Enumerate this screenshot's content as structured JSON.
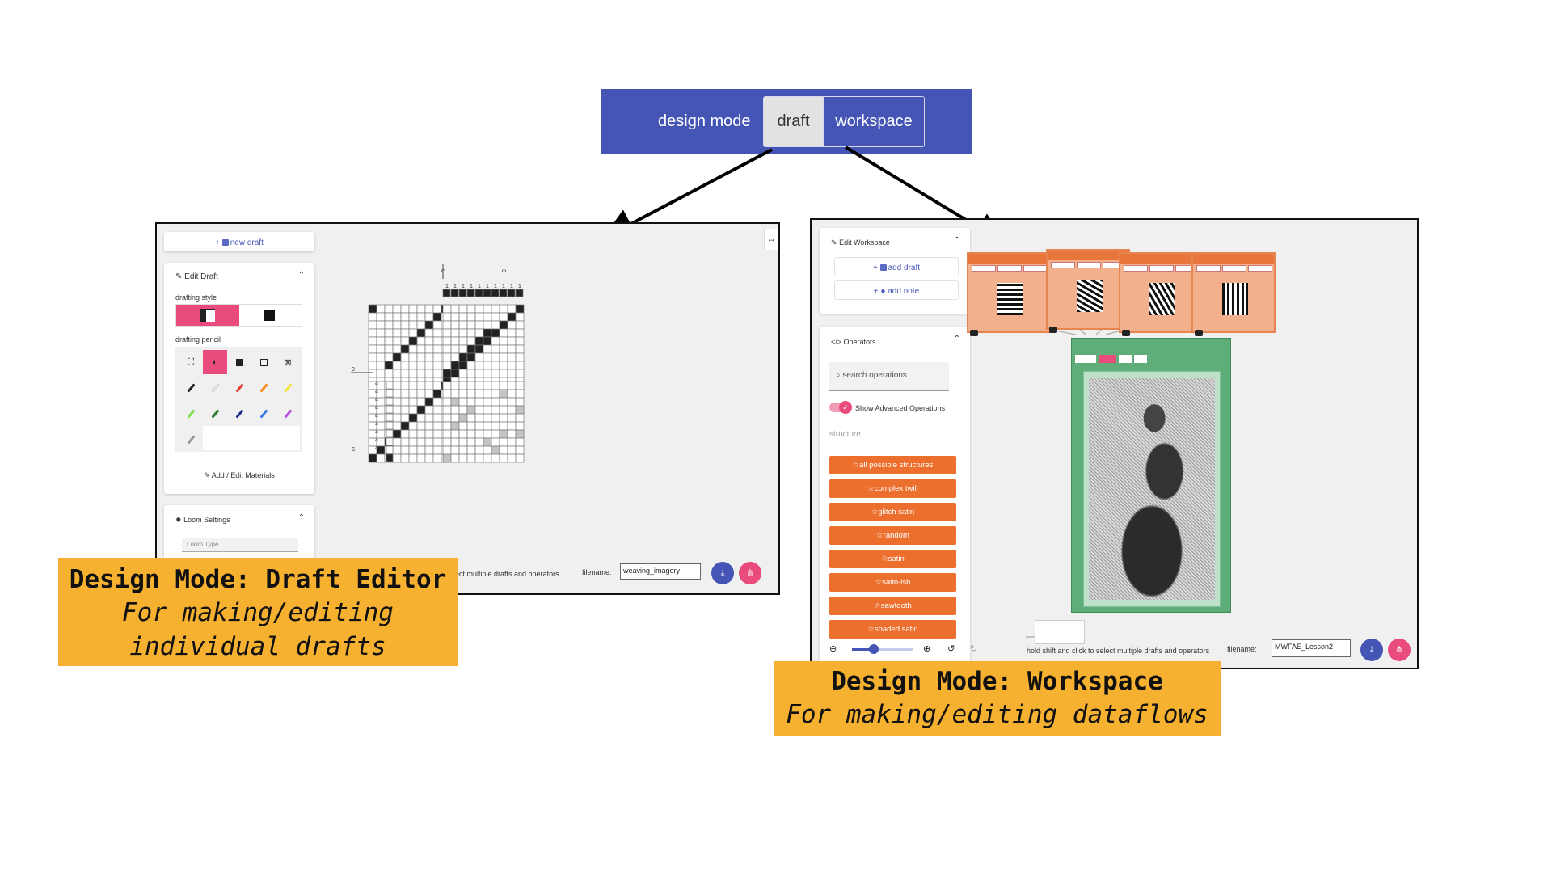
{
  "mode_switcher": {
    "label": "design mode",
    "options": [
      "draft",
      "workspace"
    ],
    "selected": "draft",
    "colors": {
      "bar": "#4455b5",
      "selected_bg": "#e2e2e2"
    }
  },
  "draft_editor": {
    "new_draft": "new draft",
    "edit_draft": {
      "title": "Edit Draft",
      "drafting_style_label": "drafting style",
      "drafting_pencil_label": "drafting pencil",
      "add_edit_materials": "Add / Edit Materials"
    },
    "loom_settings": {
      "title": "Loom Settings",
      "loom_type_placeholder": "Loom Type"
    },
    "status_hint": "elect multiple drafts and operators",
    "filename_label": "filename:",
    "filename_value": "weaving_imagery",
    "grid_labels": {
      "threading_start": "0",
      "threading_end": "9",
      "tieup_start": "0",
      "treadle_end": "9",
      "treadle_marks": [
        "a",
        "a",
        "a",
        "a",
        "a",
        "a",
        "a",
        "a",
        "a"
      ]
    },
    "tieup_numbers": [
      "1",
      "1",
      "1",
      "1",
      "1",
      "1",
      "1",
      "1",
      "1",
      "1"
    ],
    "colors": {
      "accent_pink": "#e94b7c",
      "accent_blue": "#4455b5"
    }
  },
  "workspace": {
    "edit_workspace": {
      "title": "Edit Workspace",
      "add_draft": "add draft",
      "add_note": "add note"
    },
    "operators": {
      "title": "Operators",
      "search_placeholder": "search operations",
      "show_advanced_label": "Show Advanced Operations",
      "show_advanced_on": true,
      "category": "structure",
      "items": [
        "all possible structures",
        "complex twill",
        "glitch satin",
        "random",
        "satin",
        "satin-ish",
        "sawtooth",
        "shaded satin"
      ]
    },
    "status_hint": "hold shift and click to select multiple drafts and operators",
    "filename_label": "filename:",
    "filename_value": "MWFAE_Lesson2",
    "zoom_level": 0.35,
    "colors": {
      "operator": "#ec6f2e",
      "node": "#f2b08d",
      "image_node": "#5fae7a"
    }
  },
  "captions": {
    "draft_editor": {
      "title": "Design Mode: Draft Editor",
      "subtitle_line1": "For making/editing",
      "subtitle_line2": "individual drafts"
    },
    "workspace": {
      "title": "Design Mode: Workspace",
      "subtitle": "For making/editing dataflows"
    },
    "color": "#f6b130"
  }
}
